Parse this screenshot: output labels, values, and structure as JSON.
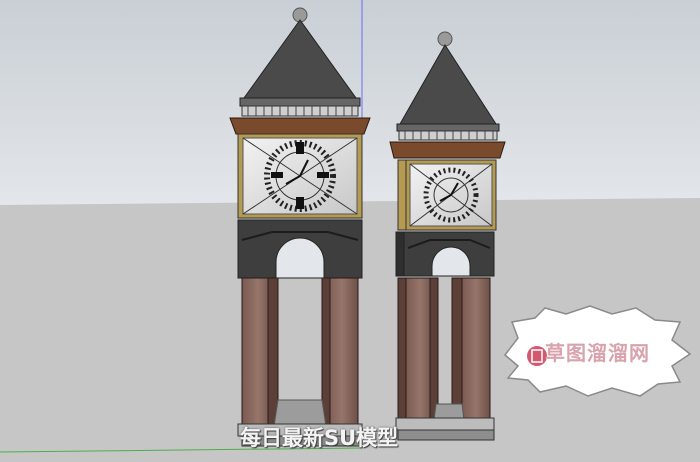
{
  "scene": {
    "sky_color": "#dbe0e5",
    "ground_color": "#c6c6c6",
    "stone_color": "#8a6a60",
    "roof_color": "#4a4a4a",
    "trim_color": "#7a4a2c",
    "clock_face_color": "#e6e6e6",
    "gold_frame_color": "#b59a52"
  },
  "caption": {
    "text": "每日最新SU模型"
  },
  "watermark": {
    "icon": "logo-stamp-icon",
    "text": "草图溜溜网"
  }
}
